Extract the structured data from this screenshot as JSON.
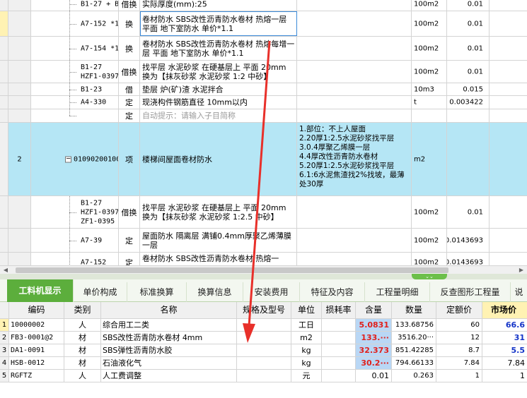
{
  "upper": {
    "rows": [
      {
        "code": "B1-27 + B1-30",
        "type": "借换",
        "name": "实际厚度(mm):25",
        "unit": "100m2",
        "qty": "0.01"
      },
      {
        "code": "A7-152 *1.1",
        "type": "换",
        "name": "卷材防水 SBS改性沥青防水卷材 热熔一层 平面  地下室防水 单价*1.1",
        "unit": "100m2",
        "qty": "0.01"
      },
      {
        "code": "A7-154 *1.1",
        "type": "换",
        "name": "卷材防水 SBS改性沥青防水卷材 热熔每增一层 平面  地下室防水 单价*1.1",
        "unit": "100m2",
        "qty": "0.01"
      },
      {
        "code": "B1-27\nHZF1-0397 ZF···",
        "type": "借换",
        "name": "找平层 水泥砂浆 在硬基层上 平面 20mm 换为【抹灰砂浆 水泥砂浆 1:2 中砂】",
        "unit": "100m2",
        "qty": "0.01"
      },
      {
        "code": "B1-23",
        "type": "借",
        "name": "垫层 炉(矿)渣 水泥拌合",
        "unit": "10m3",
        "qty": "0.015"
      },
      {
        "code": "A4-330",
        "type": "定",
        "name": "现浇构件钢筋直径 10mm以内",
        "unit": "t",
        "qty": "0.003422"
      },
      {
        "code": "",
        "type": "定",
        "name": "自动提示：请输入子目简称",
        "unit": "",
        "qty": ""
      },
      {
        "no": "2",
        "code": "010902001002",
        "type": "项",
        "name": "楼梯间屋面卷材防水",
        "features": [
          "1.部位：不上人屋面",
          "2.20厚1:2.5水泥砂浆找平层",
          "3.0.4厚聚乙烯膜一层",
          "4.4厚改性沥青防水卷材",
          "5.20厚1:2.5水泥砂浆找平层",
          "6.1:6水泥焦渣找2%找坡，最薄处30厚"
        ],
        "unit": "m2",
        "qty": ""
      },
      {
        "code": "B1-27\nHZF1-0397\nZF1-0395",
        "type": "借换",
        "name": "找平层 水泥砂浆 在硬基层上 平面 20mm 换为【抹灰砂浆 水泥砂浆 1:2.5 中砂】",
        "unit": "100m2",
        "qty": "0.01"
      },
      {
        "code": "A7-39",
        "type": "定",
        "name": "屋面防水 隔离层 满铺0.4mm厚聚乙烯薄膜一层",
        "unit": "100m2",
        "qty": "0.0143693"
      },
      {
        "code": "A7-152",
        "type": "定",
        "name": "卷材防水 SBS改性沥青防水卷材 热熔一",
        "unit": "100m2",
        "qty": "0.0143693"
      }
    ]
  },
  "tabs": [
    "工料机显示",
    "单价构成",
    "标准换算",
    "换算信息",
    "安装费用",
    "特征及内容",
    "工程量明细",
    "反查图形工程量",
    "说"
  ],
  "bottom": {
    "headers": [
      "",
      "编码",
      "类别",
      "名称",
      "规格及型号",
      "单位",
      "损耗率",
      "含量",
      "数量",
      "定额价",
      "市场价"
    ],
    "rows": [
      {
        "no": "1",
        "code": "10000002",
        "cat": "人",
        "name": "综合用工二类",
        "spec": "",
        "unit": "工日",
        "loss": "",
        "content": "5.0831",
        "qty": "133.68756",
        "price": "60",
        "market": "66.6"
      },
      {
        "no": "2",
        "code": "FB3-0001@2",
        "cat": "材",
        "name": "SBS改性沥青防水卷材 4mm",
        "spec": "",
        "unit": "m2",
        "loss": "",
        "content": "133.···",
        "qty": "3516.20···",
        "price": "12",
        "market": "31"
      },
      {
        "no": "3",
        "code": "DA1-0091",
        "cat": "材",
        "name": "SBS弹性沥青防水胶",
        "spec": "",
        "unit": "kg",
        "loss": "",
        "content": "32.373",
        "qty": "851.42285",
        "price": "8.7",
        "market": "5.5"
      },
      {
        "no": "4",
        "code": "HSB-0012",
        "cat": "材",
        "name": "石油液化气",
        "spec": "",
        "unit": "kg",
        "loss": "",
        "content": "30.2···",
        "qty": "794.66133",
        "price": "7.84",
        "market": "7.84"
      },
      {
        "no": "5",
        "code": "RGFTZ",
        "cat": "人",
        "name": "人工费调整",
        "spec": "",
        "unit": "元",
        "loss": "",
        "content": "0.01",
        "qty": "0.263",
        "price": "1",
        "market": "1"
      }
    ]
  },
  "colors": {
    "accent_green": "#5cae3c",
    "selected_row": "#b5e6f5",
    "highlight_red": "#e0201c",
    "market_blue": "#1535c8",
    "annotation_arrow": "#e8302a"
  }
}
